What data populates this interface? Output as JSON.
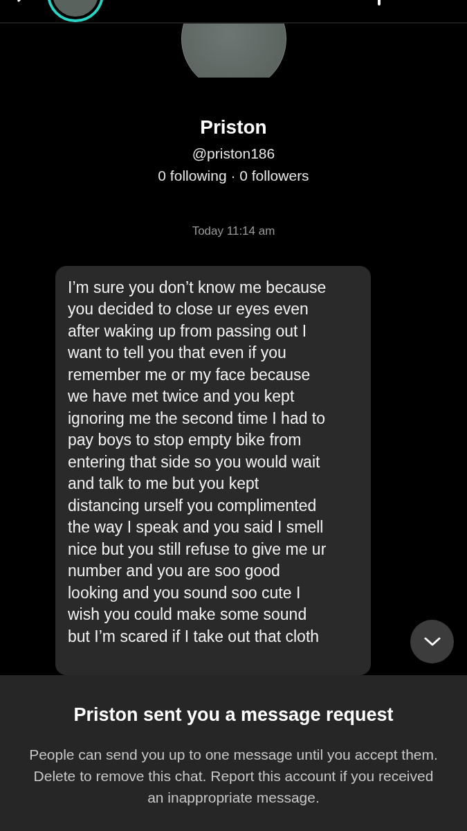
{
  "profile": {
    "name": "Priston",
    "handle": "@priston186",
    "stats": "0 following · 0 followers"
  },
  "timestamp": "Today 11:14 am",
  "message": "I’m sure you don’t know me because\nyou decided to close ur eyes even\nafter waking up from passing out I\nwant to tell you that even if you\nremember me or my face because\nwe have met twice and you kept\nignoring me the second time I had to\npay boys to stop empty bike from\nentering that side so you would wait\nand talk to me but you kept\ndistancing urself you complimented\nthe way I speak and you said I smell\nnice but you still refuse to give me ur\nnumber and you are soo good\nlooking and you sound soo cute I\nwish you could make some sound\nbut I’m scared if I take out that cloth",
  "request_panel": {
    "title": "Priston sent you a message request",
    "body": "People can send you up to one message until you accept them. Delete to remove this chat. Report this account if you received an inappropriate message."
  }
}
